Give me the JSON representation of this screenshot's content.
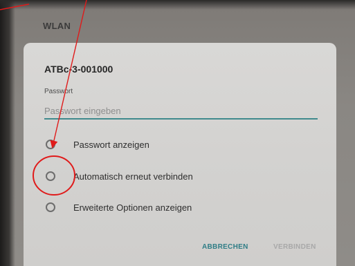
{
  "wifi": {
    "section_title": "WLAN",
    "network_name": "ATBc-3-001000",
    "password_label": "Passwort",
    "password_placeholder": "Passwort eingeben",
    "password_value": "",
    "options": [
      {
        "label": "Passwort anzeigen",
        "checked": false
      },
      {
        "label": "Automatisch erneut verbinden",
        "checked": false
      },
      {
        "label": "Erweiterte Optionen anzeigen",
        "checked": false
      }
    ],
    "cancel_label": "ABBRECHEN",
    "connect_label": "VERBINDEN"
  },
  "colors": {
    "accent": "#2f7d86",
    "annotation": "#e01a1a",
    "disabled": "#a8a8a8"
  }
}
